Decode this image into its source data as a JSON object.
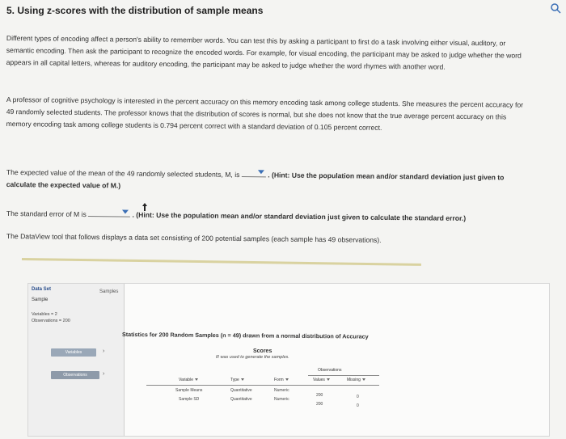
{
  "title": "5. Using z-scores with the distribution of sample means",
  "paragraph1": "Different types of encoding affect a person's ability to remember words. You can test this by asking a participant to first do a task involving either visual, auditory, or semantic encoding. Then ask the participant to recognize the encoded words. For example, for visual encoding, the participant may be asked to judge whether the word appears in all capital letters, whereas for auditory encoding, the participant may be asked to judge whether the word rhymes with another word.",
  "paragraph2": "A professor of cognitive psychology is interested in the percent accuracy on this memory encoding task among college students. She measures the percent accuracy for 49 randomly selected students. The professor knows that the distribution of scores is normal, but she does not know that the true average percent accuracy on this memory encoding task among college students is 0.794 percent correct with a standard deviation of 0.105 percent correct.",
  "question1": {
    "before": "The expected value of the mean of the 49 randomly selected students, M, is",
    "hint": ". (Hint: Use the population mean and/or standard deviation just given to calculate the expected value of M.)"
  },
  "question2": {
    "before": "The standard error of M is",
    "hint": ". (Hint: Use the population mean and/or standard deviation just given to calculate the standard error.)"
  },
  "question3": "The DataView tool that follows displays a data set consisting of 200 potential samples (each sample has 49 observations).",
  "dataview": {
    "tab_dataset": "Data Set",
    "tab_samples": "Samples",
    "sample_name": "Sample",
    "variables_line": "Variables = 2",
    "observations_line": "Observations = 200",
    "btn_variables": "Variables",
    "btn_observations": "Observations",
    "arrow": "›",
    "stat_title": "Statistics for 200 Random Samples (n = 49) drawn from a normal distribution of Accuracy",
    "stat_scores": "Scores",
    "stat_note": "R was used to generate the samples.",
    "headers": {
      "variable": "Variable",
      "type": "Type",
      "form": "Form",
      "observations": "Observations",
      "values": "Values",
      "missing": "Missing"
    },
    "rows": [
      {
        "variable": "Sample Means",
        "type": "Quantitative",
        "form": "Numeric",
        "values": "200",
        "missing": "0"
      },
      {
        "variable": "Sample SD",
        "type": "Quantitative",
        "form": "Numeric",
        "values": "200",
        "missing": "0"
      }
    ]
  }
}
